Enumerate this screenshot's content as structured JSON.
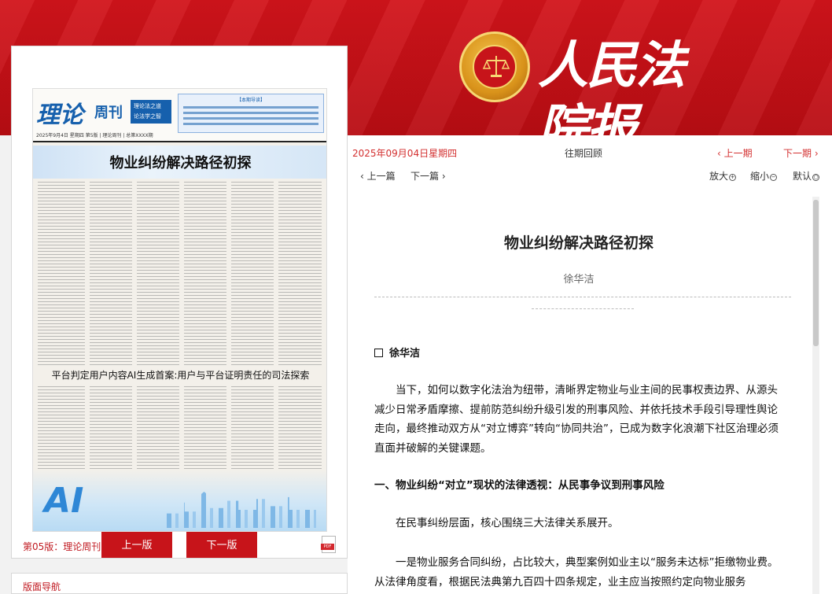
{
  "site": {
    "title": "人民法院报"
  },
  "paper": {
    "masthead": "理论",
    "masthead_suffix": "周刊",
    "promo_chip": "理论法之道 论法学之智",
    "promo_title": "【本期导读】",
    "issue_line": "2025年9月4日 星期四 第5版 | 理论周刊 | 总第XXXX期",
    "headline": "物业纠纷解决路径初探",
    "subheadline": "平台判定用户内容AI生成首案:用户与平台证明责任的司法探索",
    "ai_text": "AI"
  },
  "edition": {
    "label": "第05版：理论周刊",
    "prev_button": "上一版",
    "next_button": "下一版",
    "pdf_label": "PDF"
  },
  "section_nav": {
    "label": "版面导航"
  },
  "toolbar": {
    "date": "2025年09月04日星期四",
    "past": "往期回顾",
    "prev_period": "‹ 上一期",
    "next_period": "下一期 ›",
    "prev_article": "‹ 上一篇",
    "next_article": "下一篇 ›",
    "zoom_in": "放大",
    "zoom_out": "缩小",
    "default": "默认",
    "zoom_in_icon": "+",
    "zoom_out_icon": "−",
    "default_icon": "○"
  },
  "article": {
    "title": "物业纠纷解决路径初探",
    "author": "徐华洁",
    "byline": "徐华洁",
    "paragraphs": [
      "当下，如何以数字化法治为纽带，清晰界定物业与业主间的民事权责边界、从源头减少日常矛盾摩擦、提前防范纠纷升级引发的刑事风险、并依托技术手段引导理性舆论走向，最终推动双方从“对立博弈”转向“协同共治”，已成为数字化浪潮下社区治理必须直面并破解的关键课题。",
      "在民事纠纷层面，核心围绕三大法律关系展开。",
      "一是物业服务合同纠纷，占比较大，典型案例如业主以“服务未达标”拒缴物业费。从法律角度看，根据民法典第九百四十四条规定，业主应当按照约定向物业服务"
    ],
    "heading1": "一、物业纠纷“对立”现状的法律透视：从民事争议到刑事风险"
  }
}
